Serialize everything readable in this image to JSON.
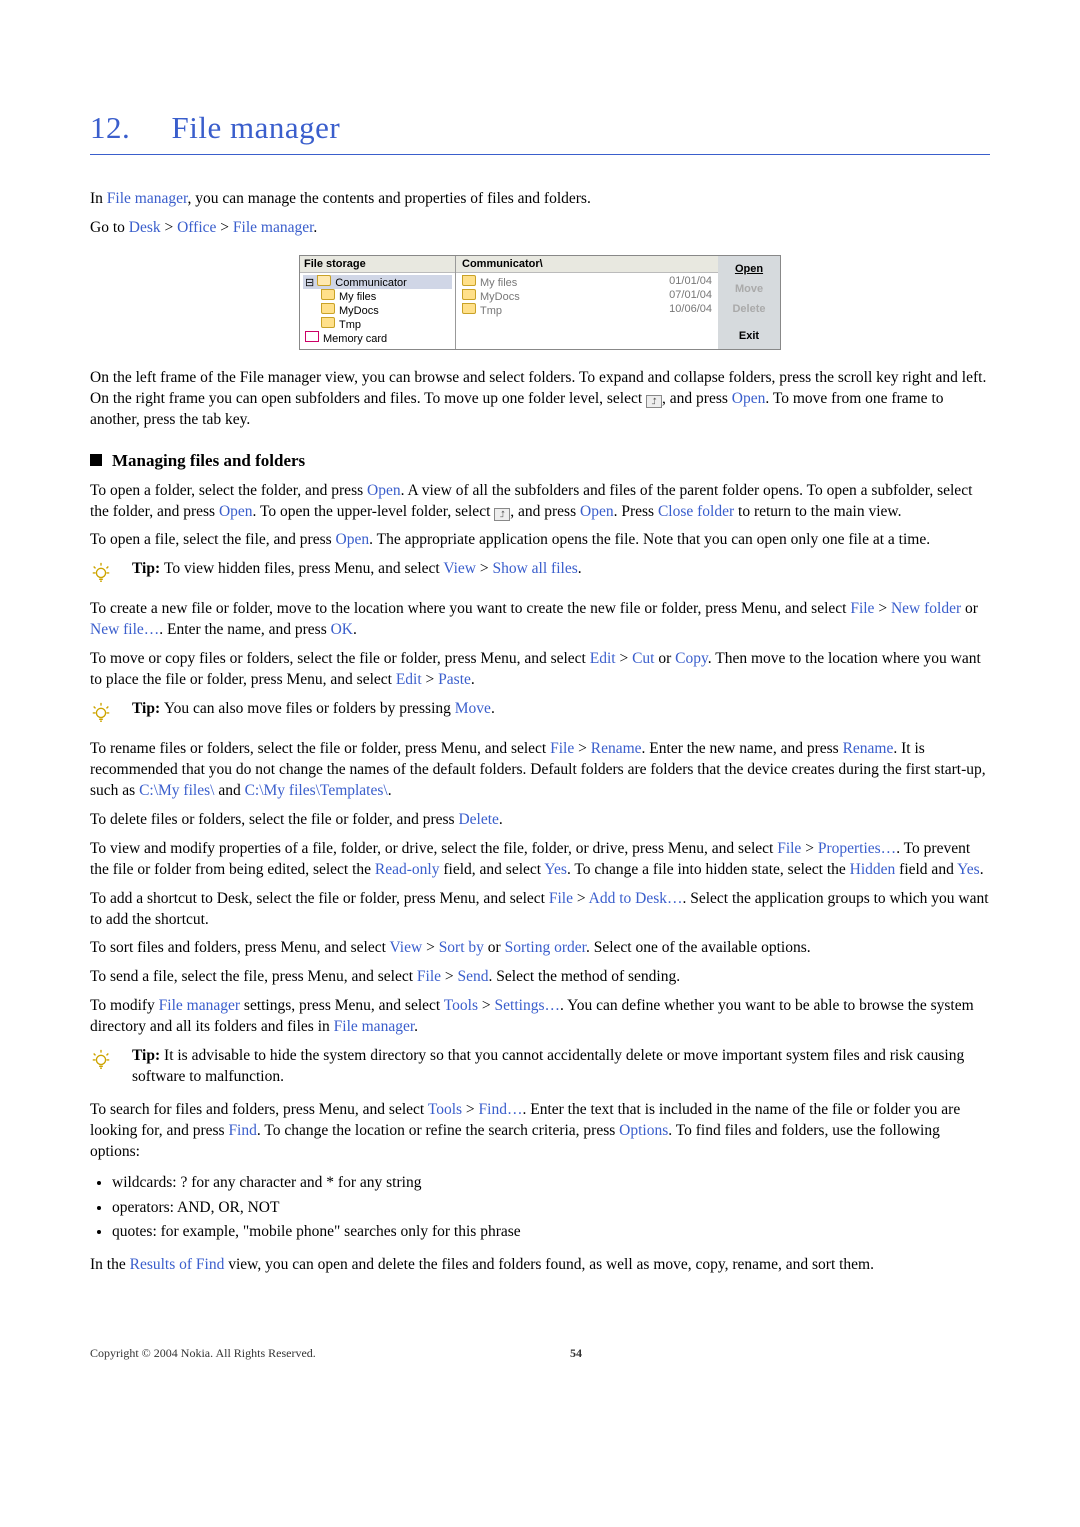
{
  "chapter_num": "12.",
  "chapter_title": "File manager",
  "intro": {
    "p1a": "In ",
    "p1b": "File manager",
    "p1c": ", you can manage the contents and properties of files and folders.",
    "p2a": "Go to ",
    "p2b": "Desk",
    "p2c": " > ",
    "p2d": "Office",
    "p2e": " > ",
    "p2f": "File manager",
    "p2g": "."
  },
  "screenshot": {
    "left_header": "File storage",
    "tree": {
      "root": "Communicator",
      "c1": "My files",
      "c2": "MyDocs",
      "c3": "Tmp",
      "card": "Memory card"
    },
    "mid_header": "Communicator\\",
    "rows": [
      {
        "name": "My files",
        "date": "01/01/04"
      },
      {
        "name": "MyDocs",
        "date": "07/01/04"
      },
      {
        "name": "Tmp",
        "date": "10/06/04"
      }
    ],
    "btns": {
      "open": "Open",
      "move": "Move",
      "delete": "Delete",
      "exit": "Exit"
    }
  },
  "after_ss": {
    "a": "On the left frame of the File manager view, you can browse and select folders. To expand and collapse folders, press the scroll key right and left. On the right frame you can open subfolders and files. To move up one folder level, select ",
    "b": ", and press ",
    "open": "Open",
    "c": ". To move from one frame to another, press the tab key."
  },
  "section1_title": "Managing files and folders",
  "mgmt": {
    "p1a": "To open a folder, select the folder, and press ",
    "open": "Open",
    "p1b": ". A view of all the subfolders and files of the parent folder opens. To open a subfolder, select the folder, and press ",
    "p1c": ". To open the upper-level folder, select ",
    "p1d": ", and press ",
    "p1e": ". Press ",
    "close_folder": "Close folder",
    "p1f": " to return to the main view.",
    "p2a": "To open a file, select the file, and press ",
    "p2b": ". The appropriate application opens the file. Note that you can open only one file at a time."
  },
  "tip1": {
    "label": "Tip: ",
    "a": "To view hidden files, press Menu, and select ",
    "view": "View",
    "gt": " > ",
    "showall": "Show all files",
    "end": "."
  },
  "create": {
    "a": "To create a new file or folder, move to the location where you want to create the new file or folder, press Menu, and select ",
    "file": "File",
    "gt": " > ",
    "newfolder": "New folder",
    "or": " or ",
    "newfile": "New file…",
    "b": ". Enter the name, and press ",
    "ok": "OK",
    "end": "."
  },
  "movecopy": {
    "a": "To move or copy files or folders, select the file or folder, press Menu, and select ",
    "edit": "Edit",
    "gt": " > ",
    "cut": "Cut",
    "or": " or ",
    "copy": "Copy",
    "b": ". Then move to the location where you want to place the file or folder, press Menu, and select ",
    "paste": "Paste",
    "end": "."
  },
  "tip2": {
    "label": "Tip: ",
    "a": "You can also move files or folders by pressing ",
    "move": "Move",
    "end": "."
  },
  "rename": {
    "a": "To rename files or folders, select the file or folder, press Menu, and select ",
    "file": "File",
    "gt": " > ",
    "rename": "Rename",
    "b": ". Enter the new name, and press ",
    "c": ". It is recommended that you do not change the names of the default folders. Default folders are folders that the device creates during the first start-up, such as ",
    "path1": "C:\\My files\\",
    "and": " and ",
    "path2": "C:\\My files\\Templates\\",
    "end": "."
  },
  "delete": {
    "a": "To delete files or folders, select the file or folder, and press ",
    "del": "Delete",
    "end": "."
  },
  "props": {
    "a": "To view and modify properties of a file, folder, or drive, select the file, folder, or drive, press Menu, and select ",
    "file": "File",
    "gt": " > ",
    "properties": "Properties…",
    "b": ". To prevent the file or folder from being edited, select the ",
    "readonly": "Read-only",
    "c": " field, and select ",
    "yes": "Yes",
    "d": ". To change a file into hidden state, select the ",
    "hidden": "Hidden",
    "e": " field and ",
    "end": "."
  },
  "adddesk": {
    "a": "To add a shortcut to Desk, select the file or folder, press Menu, and select ",
    "file": "File",
    "gt": " > ",
    "add": "Add to Desk…",
    "b": ". Select the application groups to which you want to add the shortcut."
  },
  "sort": {
    "a": "To sort files and folders, press Menu, and select ",
    "view": "View",
    "gt": " > ",
    "sortby": "Sort by",
    "or": " or ",
    "sorder": "Sorting order",
    "b": ". Select one of the available options."
  },
  "send": {
    "a": "To send a file, select the file, press Menu, and select ",
    "file": "File",
    "gt": " > ",
    "send2": "Send",
    "b": ". Select the method of sending."
  },
  "settings": {
    "a": "To modify ",
    "fm": "File manager",
    "b": " settings, press Menu, and select ",
    "tools": "Tools",
    "gt": " > ",
    "settings2": "Settings…",
    "c": ". You can define whether you want to be able to browse the system directory and all its folders and files in ",
    "end": "."
  },
  "tip3": {
    "label": "Tip: ",
    "a": " It is advisable to hide the system directory so that you cannot accidentally delete or move important system files and risk causing software to malfunction."
  },
  "find": {
    "a": "To search for files and folders, press Menu, and select ",
    "tools": "Tools",
    "gt": " > ",
    "find2": "Find…",
    "b": ". Enter the text that is included in the name of the file or folder you are looking for, and press ",
    "find3": "Find",
    "c": ". To change the location or refine the search criteria, press ",
    "options": "Options",
    "d": ". To find files and folders, use the following options:"
  },
  "bullets": {
    "b1": "wildcards: ? for any character and * for any string",
    "b2": "operators: AND, OR, NOT",
    "b3": "quotes: for example, \"mobile phone\" searches only for this phrase"
  },
  "results": {
    "a": "In the ",
    "rof": "Results of Find",
    "b": " view, you can open and delete the files and folders found, as well as move, copy, rename, and sort them."
  },
  "footer": {
    "copyright": "Copyright © 2004 Nokia. All Rights Reserved.",
    "page": "54"
  }
}
